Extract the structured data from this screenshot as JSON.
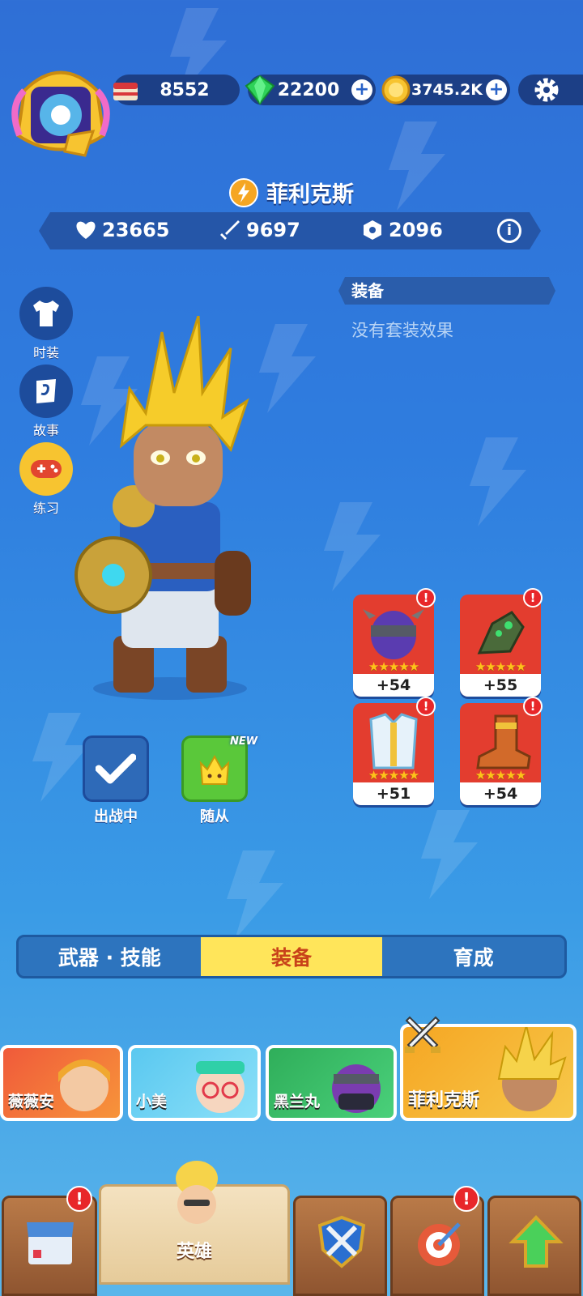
{
  "resources": {
    "cake": {
      "value": "8552",
      "icon": "cake-icon"
    },
    "gems": {
      "value": "22200",
      "icon": "gem-icon"
    },
    "gold": {
      "value": "3745.2K",
      "icon": "gold-coin-icon"
    }
  },
  "hero": {
    "name": "菲利克斯",
    "stats": {
      "health": "23665",
      "attack": "9697",
      "defense": "2096"
    }
  },
  "side_menu": [
    {
      "label": "时装",
      "icon": "shirt-icon"
    },
    {
      "label": "故事",
      "icon": "story-icon"
    },
    {
      "label": "练习",
      "icon": "gamepad-icon"
    }
  ],
  "equipment": {
    "title": "装备",
    "set_note": "没有套装效果",
    "items": [
      {
        "name": "helmet",
        "bonus": "+54",
        "stars": 5
      },
      {
        "name": "gloves",
        "bonus": "+55",
        "stars": 5
      },
      {
        "name": "armor",
        "bonus": "+51",
        "stars": 5
      },
      {
        "name": "boots",
        "bonus": "+54",
        "stars": 5
      }
    ]
  },
  "actions": {
    "deployed": "出战中",
    "follower": "随从",
    "new_badge": "NEW"
  },
  "tabs": [
    {
      "label": "武器 · 技能",
      "active": false
    },
    {
      "label": "装备",
      "active": true
    },
    {
      "label": "育成",
      "active": false
    }
  ],
  "hero_list": [
    {
      "name": "薇薇安"
    },
    {
      "name": "小美"
    },
    {
      "name": "黑兰丸"
    },
    {
      "name": "菲利克斯"
    }
  ],
  "bottom_nav": {
    "active_label": "英雄"
  },
  "colors": {
    "accent_yellow": "#ffe55a",
    "pill_bg": "#1c3f86",
    "alert_red": "#e8272a"
  }
}
